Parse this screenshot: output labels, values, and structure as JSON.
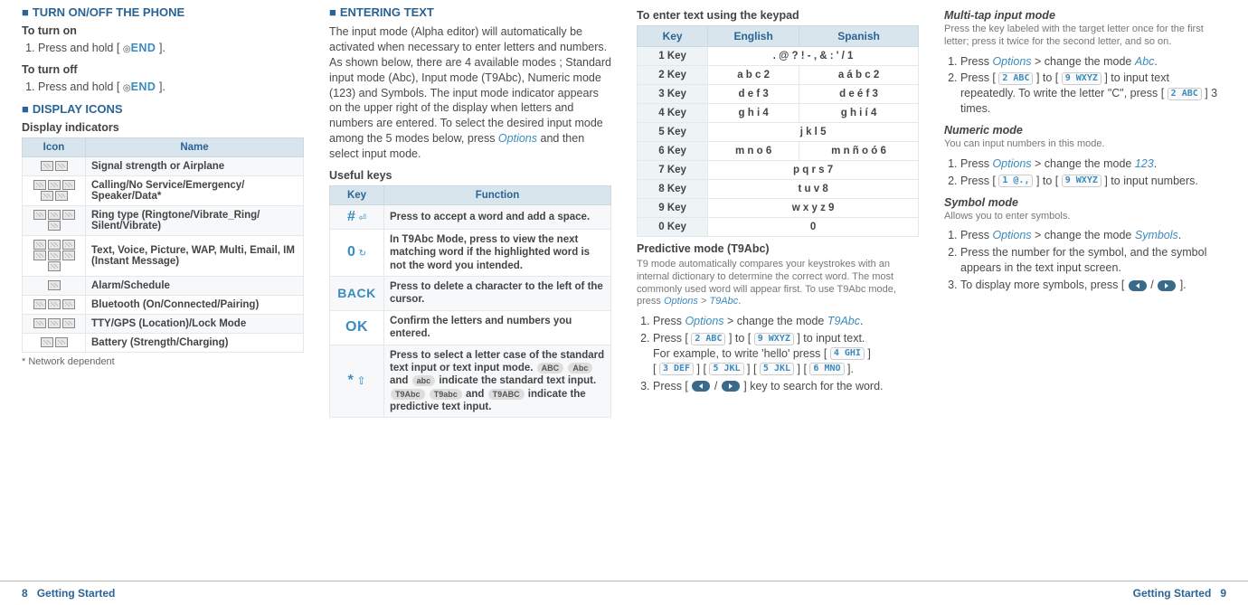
{
  "col1": {
    "h_phone": "TURN ON/OFF THE PHONE",
    "turn_on_h": "To turn on",
    "turn_on_step": "Press and hold [",
    "turn_off_h": "To turn off",
    "turn_off_step": "Press and hold [",
    "end_key": "END",
    "bracket_close": " ].",
    "h_icons": "DISPLAY ICONS",
    "indicators_h": "Display indicators",
    "tbl_h_icon": "Icon",
    "tbl_h_name": "Name",
    "rows": [
      "Signal strength or Airplane",
      "Calling/No Service/Emergency/ Speaker/Data*",
      "Ring type (Ringtone/Vibrate_Ring/ Silent/Vibrate)",
      "Text, Voice, Picture, WAP, Multi, Email, IM (Instant Message)",
      "Alarm/Schedule",
      "Bluetooth (On/Connected/Pairing)",
      "TTY/GPS (Location)/Lock Mode",
      "Battery (Strength/Charging)"
    ],
    "footnote": "* Network dependent"
  },
  "col2": {
    "h_enter": "ENTERING TEXT",
    "intro": "The input mode (Alpha editor) will automatically be activated when necessary to enter letters and numbers. As shown below, there are 4 available modes ; Standard input mode (Abc), Input mode (T9Abc), Numeric mode (123) and Symbols. The input mode indicator appears on the upper right of the display when letters and numbers are entered. To select the desired input mode among the 5 modes below, press ",
    "intro_opt": "Options",
    "intro_tail": " and then select input mode.",
    "useful_h": "Useful keys",
    "tbl_h_key": "Key",
    "tbl_h_func": "Function",
    "k_hash": "#",
    "f_hash": "Press to accept a word and add a space.",
    "k_zero": "0",
    "f_zero": "In T9Abc Mode, press to view the next matching word if the highlighted word is not the word you intended.",
    "k_back": "BACK",
    "f_back": "Press to delete a character to the left of the cursor.",
    "k_ok": "OK",
    "f_ok": "Confirm the letters and numbers you entered.",
    "k_star": "*",
    "f_star_a": "Press to select a letter case of the standard text input or text input mode. ",
    "f_star_b": " indicate the standard text input. ",
    "f_star_c": " indicate the predictive text input.",
    "m_ABC": "ABC",
    "m_Abc": "Abc",
    "m_abc": "abc",
    "m_T9Abc": "T9Abc",
    "m_T9abc": "T9abc",
    "m_T9ABC": "T9ABC",
    "and": " and "
  },
  "col3": {
    "h_keypad": "To enter text using the keypad",
    "th_key": "Key",
    "th_en": "English",
    "th_es": "Spanish",
    "rows": [
      {
        "k": "1 Key",
        "en": ". @ ? ! - , & : ' / 1",
        "es": ""
      },
      {
        "k": "2 Key",
        "en": "a b c 2",
        "es": "a á b c 2"
      },
      {
        "k": "3 Key",
        "en": "d e f 3",
        "es": "d e é f 3"
      },
      {
        "k": "4 Key",
        "en": "g h i 4",
        "es": "g h i í 4"
      },
      {
        "k": "5 Key",
        "en": "j k l 5",
        "es": ""
      },
      {
        "k": "6 Key",
        "en": "m n o 6",
        "es": "m n ñ o ó 6"
      },
      {
        "k": "7 Key",
        "en": "p q r s 7",
        "es": ""
      },
      {
        "k": "8 Key",
        "en": "t u v 8",
        "es": ""
      },
      {
        "k": "9 Key",
        "en": "w x y z 9",
        "es": ""
      },
      {
        "k": "0 Key",
        "en": "0",
        "es": ""
      }
    ],
    "pred_h": "Predictive mode (T9Abc)",
    "pred_intro_a": "T9 mode automatically compares your keystrokes with an internal dictionary to determine the correct word. The most commonly used word will appear first. To use T9Abc mode, press ",
    "pred_intro_opt": "Options",
    "pred_intro_gt": " > ",
    "pred_intro_mode": "T9Abc",
    "dot": ".",
    "s1_a": "Press ",
    "s1_opt": "Options",
    "s1_b": " > change the mode ",
    "s1_mode": "T9Abc",
    "s2_a": "Press [ ",
    "s2_b": " ] to [ ",
    "s2_c": " ] to input text.",
    "s2_line2_a": "For example, to write 'hello' press [ ",
    "s2_line2_b": " ]",
    "s2_line3_a": "[ ",
    "s2_line3_b": " ] [ ",
    "s2_line3_c": " ] [ ",
    "s2_line3_d": " ] [ ",
    "s2_line3_e": " ].",
    "s3_a": "Press [ ",
    "s3_b": " / ",
    "s3_c": " ] key to search for the word.",
    "kb_2": "2 ABC",
    "kb_9": "9 WXYZ",
    "kb_4": "4 GHI",
    "kb_3": "3 DEF",
    "kb_5": "5 JKL",
    "kb_6": "6 MNO",
    "kb_1": "1 @.,"
  },
  "col4": {
    "multi_h": "Multi-tap input mode",
    "multi_intro": "Press the key labeled with the target letter once for the first letter; press it twice for the second letter, and so on.",
    "m1_a": "Press ",
    "m1_opt": "Options",
    "m1_b": " > change the mode ",
    "m1_mode": "Abc",
    "m2_a": "Press [ ",
    "m2_b": " ] to [ ",
    "m2_c": " ] to input text repeatedly. To write the letter \"C\", press [ ",
    "m2_d": " ] 3 times.",
    "num_h": "Numeric mode",
    "num_intro": "You can input numbers in this mode.",
    "n1_a": "Press ",
    "n1_opt": "Options",
    "n1_b": " > change the mode ",
    "n1_mode": "123",
    "n2_a": "Press [ ",
    "n2_b": " ] to [ ",
    "n2_c": " ] to input numbers.",
    "sym_h": "Symbol mode",
    "sym_intro": "Allows you to enter symbols.",
    "s1_a": "Press ",
    "s1_opt": "Options",
    "s1_b": " > change the mode ",
    "s1_mode": "Symbols",
    "s2": "Press the number for the symbol, and the symbol appears in the text input screen.",
    "s3_a": "To display more symbols, press [ ",
    "s3_b": " / ",
    "s3_c": " ].",
    "kb_2": "2 ABC",
    "kb_9": "9 WXYZ",
    "kb_1": "1 @.,"
  },
  "footer": {
    "left_num": "8",
    "left_lbl": "Getting Started",
    "right_lbl": "Getting Started",
    "right_num": "9"
  }
}
